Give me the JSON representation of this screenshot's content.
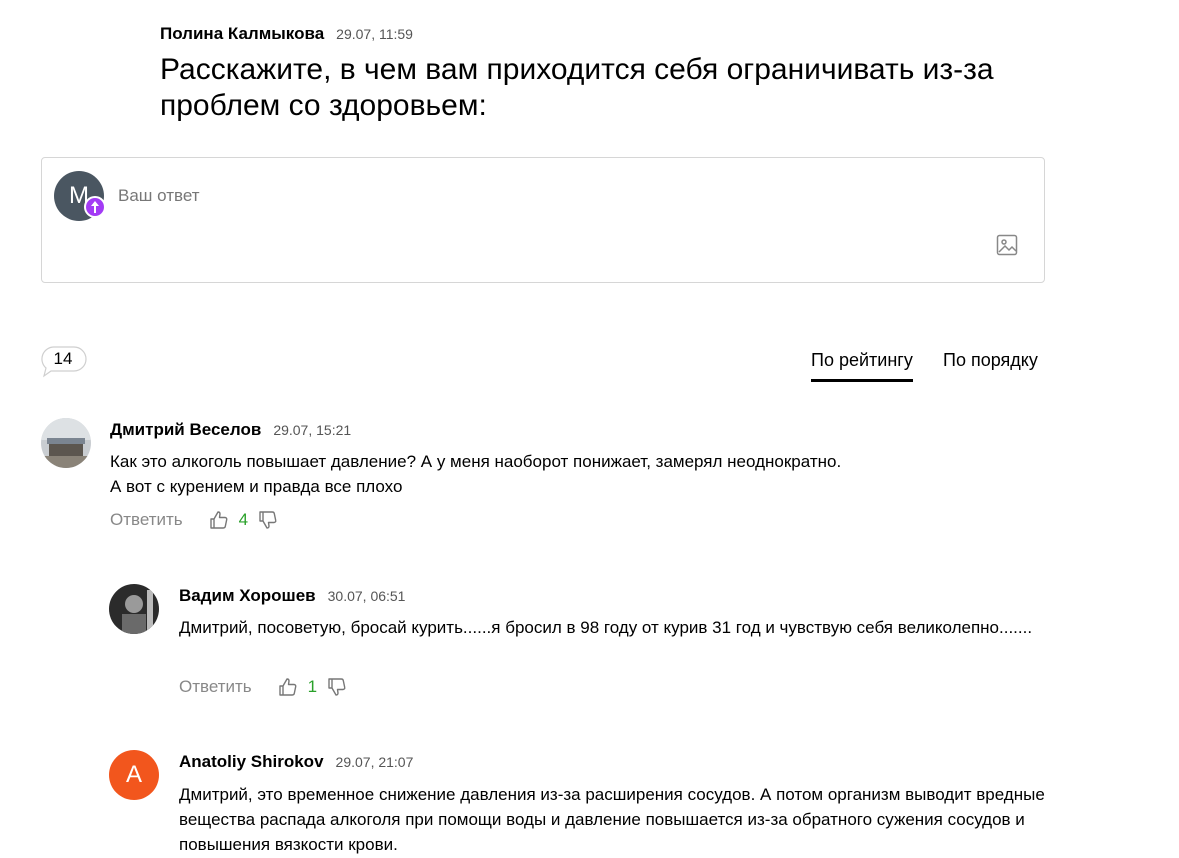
{
  "post": {
    "author": "Полина Калмыкова",
    "time": "29.07, 11:59",
    "question": "Расскажите, в чем вам приходится себя ограничивать из-за проблем со здоровьем:"
  },
  "reply_box": {
    "avatar_letter": "М",
    "placeholder": "Ваш ответ"
  },
  "comments_count": "14",
  "sort": {
    "by_rating": "По рейтингу",
    "by_order": "По порядку"
  },
  "comments": [
    {
      "author": "Дмитрий Веселов",
      "time": "29.07, 15:21",
      "text": "Как это алкоголь повышает давление? А у меня наоборот понижает, замерял неоднократно.\nА вот с курением и правда все плохо",
      "reply_label": "Ответить",
      "likes": "4"
    },
    {
      "author": "Вадим Хорошев",
      "time": "30.07, 06:51",
      "text": "Дмитрий, посоветую, бросай курить......я бросил в 98 году от курив 31 год и чувствую себя великолепно.......",
      "reply_label": "Ответить",
      "likes": "1"
    },
    {
      "author": "Anatoliy Shirokov",
      "avatar_letter": "A",
      "time": "29.07, 21:07",
      "text": "Дмитрий, это временное снижение давления из-за расширения сосудов. А потом организм выводит вредные вещества распада алкоголя при помощи воды и давление повышается из-за обратного сужения сосудов и повышения вязкости крови."
    }
  ],
  "colors": {
    "accent_like": "#2aa12a",
    "badge_purple": "#a33bf5",
    "avatar_orange": "#f2561d"
  }
}
